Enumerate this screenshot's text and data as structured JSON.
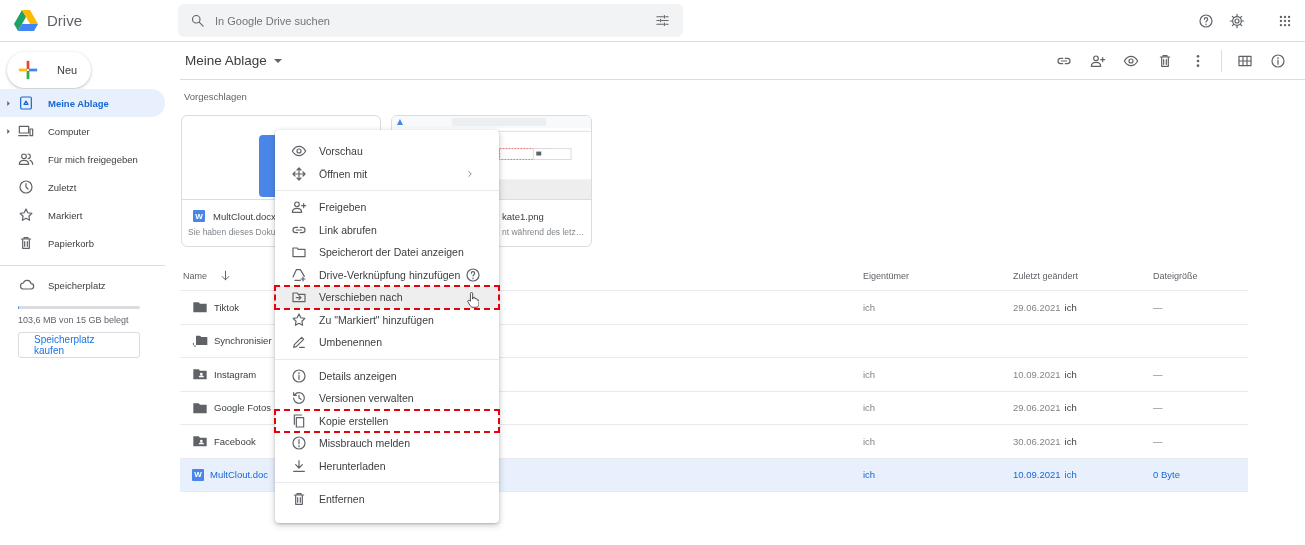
{
  "header": {
    "logo_text": "Drive",
    "search": {
      "placeholder": "In Google Drive suchen"
    }
  },
  "sidebar": {
    "new_button": "Neu",
    "items": [
      {
        "label": "Meine Ablage",
        "selected": true,
        "expandable": true
      },
      {
        "label": "Computer",
        "selected": false,
        "expandable": true
      },
      {
        "label": "Für mich freigegeben",
        "selected": false,
        "expandable": false
      },
      {
        "label": "Zuletzt",
        "selected": false,
        "expandable": false
      },
      {
        "label": "Markiert",
        "selected": false,
        "expandable": false
      },
      {
        "label": "Papierkorb",
        "selected": false,
        "expandable": false
      }
    ],
    "storage": {
      "label": "Speicherplatz",
      "level": 0.01,
      "usage": "103,6 MB von 15 GB belegt",
      "buy_button": "Speicherplatz kaufen"
    }
  },
  "toolbar": {
    "title": "Meine Ablage"
  },
  "suggested": {
    "heading": "Vorgeschlagen",
    "cards": [
      {
        "kind": "document",
        "file_letter": "W",
        "title": "MultClout.docx",
        "subtitle": "Sie haben dieses Doku"
      },
      {
        "title": "kate1.png",
        "subtitle": "nt während des letz…"
      }
    ]
  },
  "table": {
    "columns": [
      "Name",
      "Eigentümer",
      "Zuletzt geändert",
      "Dateigröße"
    ],
    "rows": [
      {
        "kind": "folder",
        "name": "Tiktok",
        "owner": "ich",
        "modified": "29.06.2021",
        "modified_by": "ich",
        "size": "—",
        "selected": false
      },
      {
        "kind": "sync_folder",
        "name": "Synchronisier",
        "selected": false
      },
      {
        "kind": "shared_folder",
        "name": "Instagram",
        "owner": "ich",
        "modified": "10.09.2021",
        "modified_by": "ich",
        "size": "—",
        "selected": false
      },
      {
        "kind": "folder",
        "name": "Google Fotos",
        "owner": "ich",
        "modified": "29.06.2021",
        "modified_by": "ich",
        "size": "—",
        "selected": false
      },
      {
        "kind": "shared_folder",
        "name": "Facebook",
        "owner": "ich",
        "modified": "30.06.2021",
        "modified_by": "ich",
        "size": "—",
        "selected": false
      },
      {
        "kind": "document",
        "file_letter": "W",
        "name": "MultClout.doc",
        "owner": "ich",
        "modified": "10.09.2021",
        "modified_by": "ich",
        "size": "0 Byte",
        "selected": true
      }
    ]
  },
  "context_menu": {
    "groups": [
      {
        "items": [
          {
            "label": "Vorschau",
            "hovered": false,
            "annotated": false,
            "submenu": false,
            "help": false
          },
          {
            "label": "Öffnen mit",
            "hovered": false,
            "annotated": false,
            "submenu": true,
            "help": false
          }
        ]
      },
      {
        "items": [
          {
            "label": "Freigeben",
            "hovered": false,
            "annotated": false,
            "submenu": false,
            "help": false
          },
          {
            "label": "Link abrufen",
            "hovered": false,
            "annotated": false,
            "submenu": false,
            "help": false
          },
          {
            "label": "Speicherort der Datei anzeigen",
            "hovered": false,
            "annotated": false,
            "submenu": false,
            "help": false
          },
          {
            "label": "Drive-Verknüpfung hinzufügen",
            "hovered": false,
            "annotated": false,
            "submenu": false,
            "help": true
          },
          {
            "label": "Verschieben nach",
            "hovered": true,
            "annotated": true,
            "submenu": false,
            "help": false
          },
          {
            "label": "Zu \"Markiert\" hinzufügen",
            "hovered": false,
            "annotated": false,
            "submenu": false,
            "help": false
          },
          {
            "label": "Umbenennen",
            "hovered": false,
            "annotated": false,
            "submenu": false,
            "help": false
          }
        ]
      },
      {
        "items": [
          {
            "label": "Details anzeigen",
            "hovered": false,
            "annotated": false,
            "submenu": false,
            "help": false
          },
          {
            "label": "Versionen verwalten",
            "hovered": false,
            "annotated": false,
            "submenu": false,
            "help": false
          },
          {
            "label": "Kopie erstellen",
            "hovered": false,
            "annotated": true,
            "submenu": false,
            "help": false
          },
          {
            "label": "Missbrauch melden",
            "hovered": false,
            "annotated": false,
            "submenu": false,
            "help": false
          },
          {
            "label": "Herunterladen",
            "hovered": false,
            "annotated": false,
            "submenu": false,
            "help": false
          }
        ]
      },
      {
        "items": [
          {
            "label": "Entfernen",
            "hovered": false,
            "annotated": false,
            "submenu": false,
            "help": false
          }
        ]
      }
    ]
  }
}
